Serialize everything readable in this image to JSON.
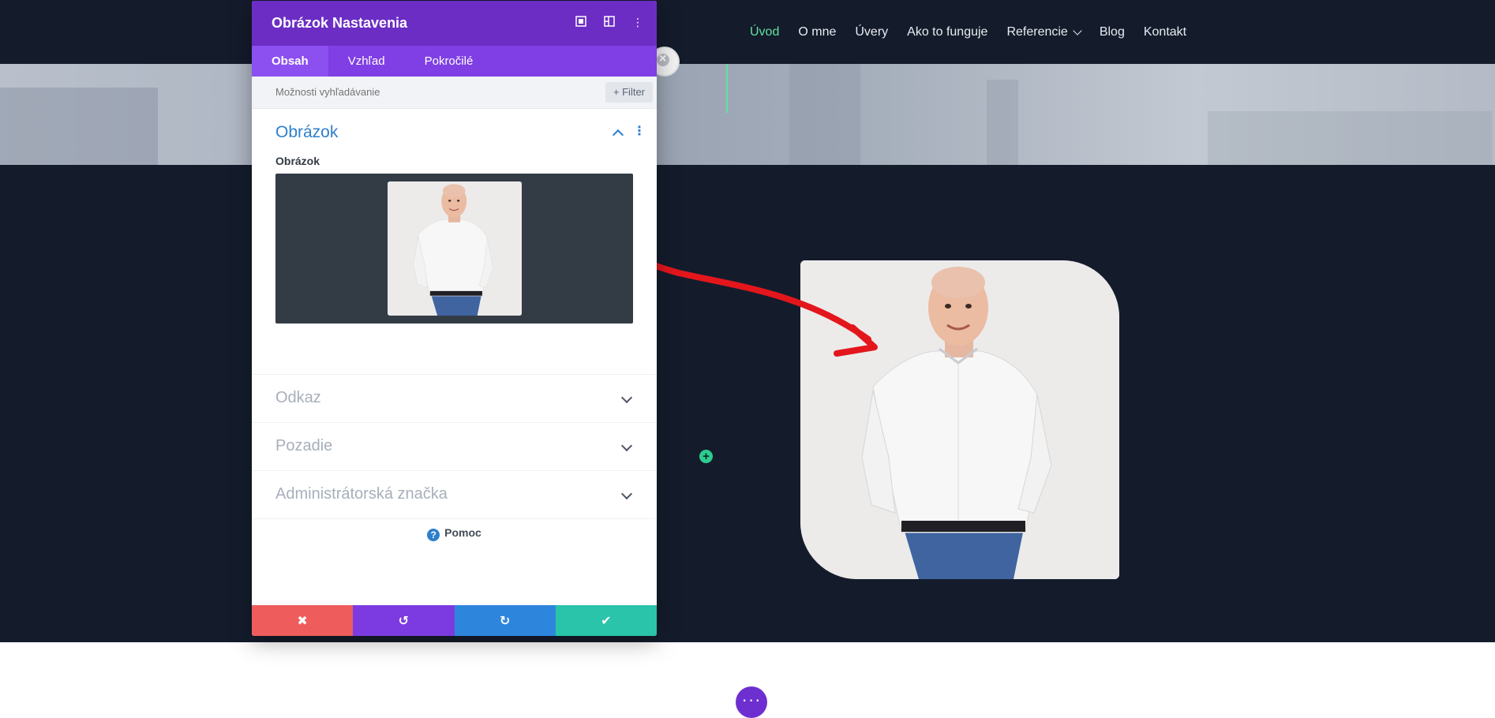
{
  "nav": {
    "items": [
      {
        "label": "Úvod",
        "active": true
      },
      {
        "label": "O mne"
      },
      {
        "label": "Úvery"
      },
      {
        "label": "Ako to funguje"
      },
      {
        "label": "Referencie",
        "has_dropdown": true
      },
      {
        "label": "Blog"
      },
      {
        "label": "Kontakt"
      }
    ]
  },
  "modal": {
    "title": "Obrázok Nastavenia",
    "tabs": [
      {
        "label": "Obsah",
        "active": true
      },
      {
        "label": "Vzhľad"
      },
      {
        "label": "Pokročilé"
      }
    ],
    "search": {
      "placeholder": "Možnosti vyhľadávanie"
    },
    "filter_label": "Filter",
    "open_section": {
      "title": "Obrázok",
      "field_label": "Obrázok"
    },
    "collapsed_sections": [
      {
        "label": "Odkaz"
      },
      {
        "label": "Pozadie"
      },
      {
        "label": "Administrátorská značka"
      }
    ],
    "help_label": "Pomoc"
  },
  "colors": {
    "header_bg": "#141b2b",
    "modal_header": "#6c2dc5",
    "modal_tabs": "#7f3fe4",
    "accent_blue": "#2e7fcc",
    "nav_active": "#5fe3a0",
    "btn_cancel": "#ef5c5c",
    "btn_undo": "#7c3be0",
    "btn_redo": "#2e86dc",
    "btn_save": "#29c4a9"
  },
  "icons": {
    "head": [
      "fullscreen-icon",
      "split-view-icon",
      "more-icon"
    ],
    "footer": [
      "close-icon",
      "undo-icon",
      "redo-icon",
      "check-icon"
    ]
  }
}
